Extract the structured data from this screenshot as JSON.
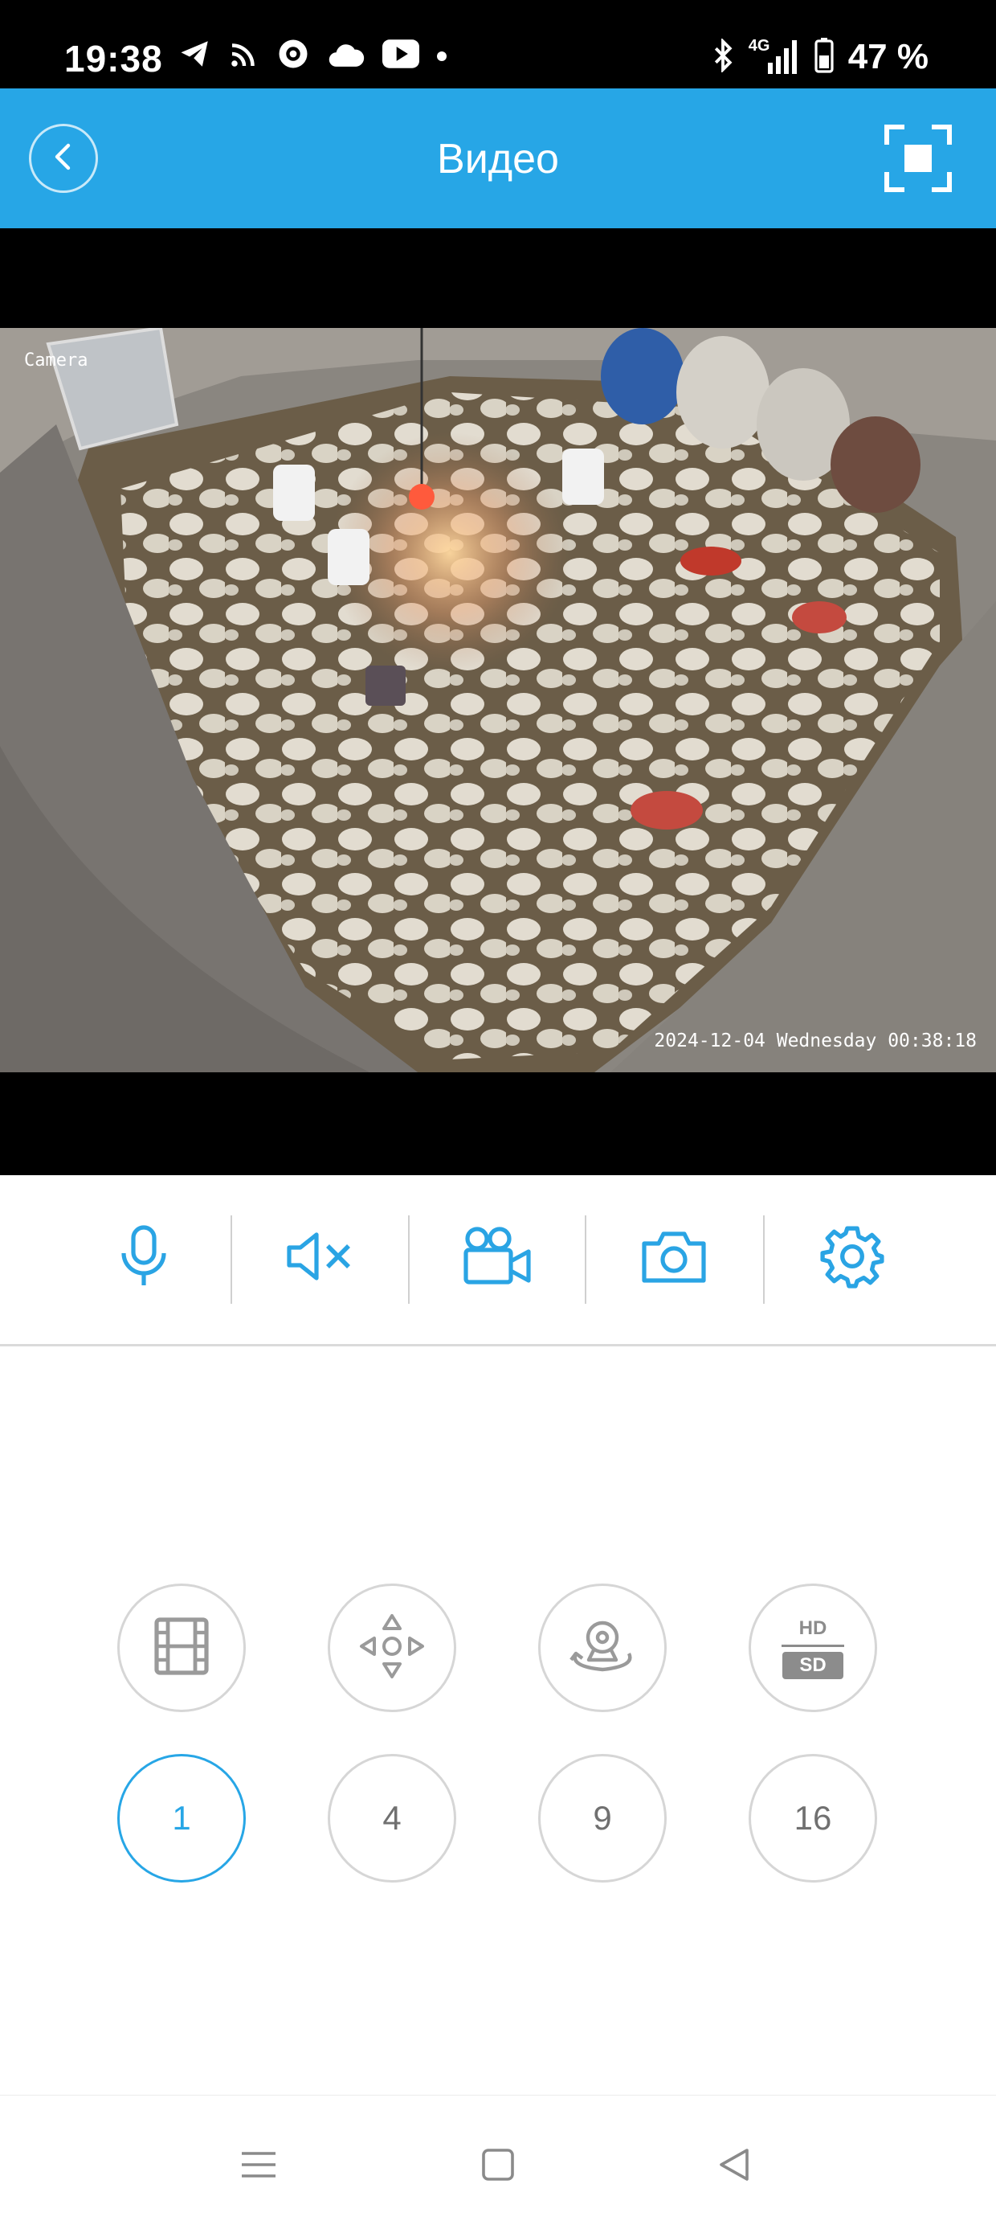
{
  "status_bar": {
    "time": "19:38",
    "network": "4G",
    "battery": "47 %",
    "icons_left": [
      "telegram-icon",
      "cast-icon",
      "vpn-globe-icon",
      "cloud-icon",
      "youtube-icon",
      "notification-dot"
    ],
    "icons_right": [
      "bluetooth-icon",
      "signal-icon",
      "battery-icon"
    ]
  },
  "header": {
    "title": "Видео",
    "back_icon": "chevron-left-icon",
    "fullscreen_icon": "fullscreen-icon"
  },
  "video": {
    "camera_label": "Camera",
    "timestamp": "2024-12-04 Wednesday 00:38:18"
  },
  "toolbar": {
    "tools": [
      "microphone-icon",
      "speaker-muted-icon",
      "video-record-icon",
      "camera-snapshot-icon",
      "settings-gear-icon"
    ]
  },
  "controls": {
    "hd_label": "HD",
    "sd_label": "SD",
    "layouts": [
      "1",
      "4",
      "9",
      "16"
    ],
    "selected_layout": "1"
  },
  "colors": {
    "accent": "#27a6e6",
    "icon_blue": "#2aa4e4",
    "control_border": "#d6d6d6",
    "control_icon": "#9a9a9a"
  },
  "navbar": {
    "icons": [
      "menu-icon",
      "home-square-icon",
      "back-triangle-icon"
    ]
  }
}
